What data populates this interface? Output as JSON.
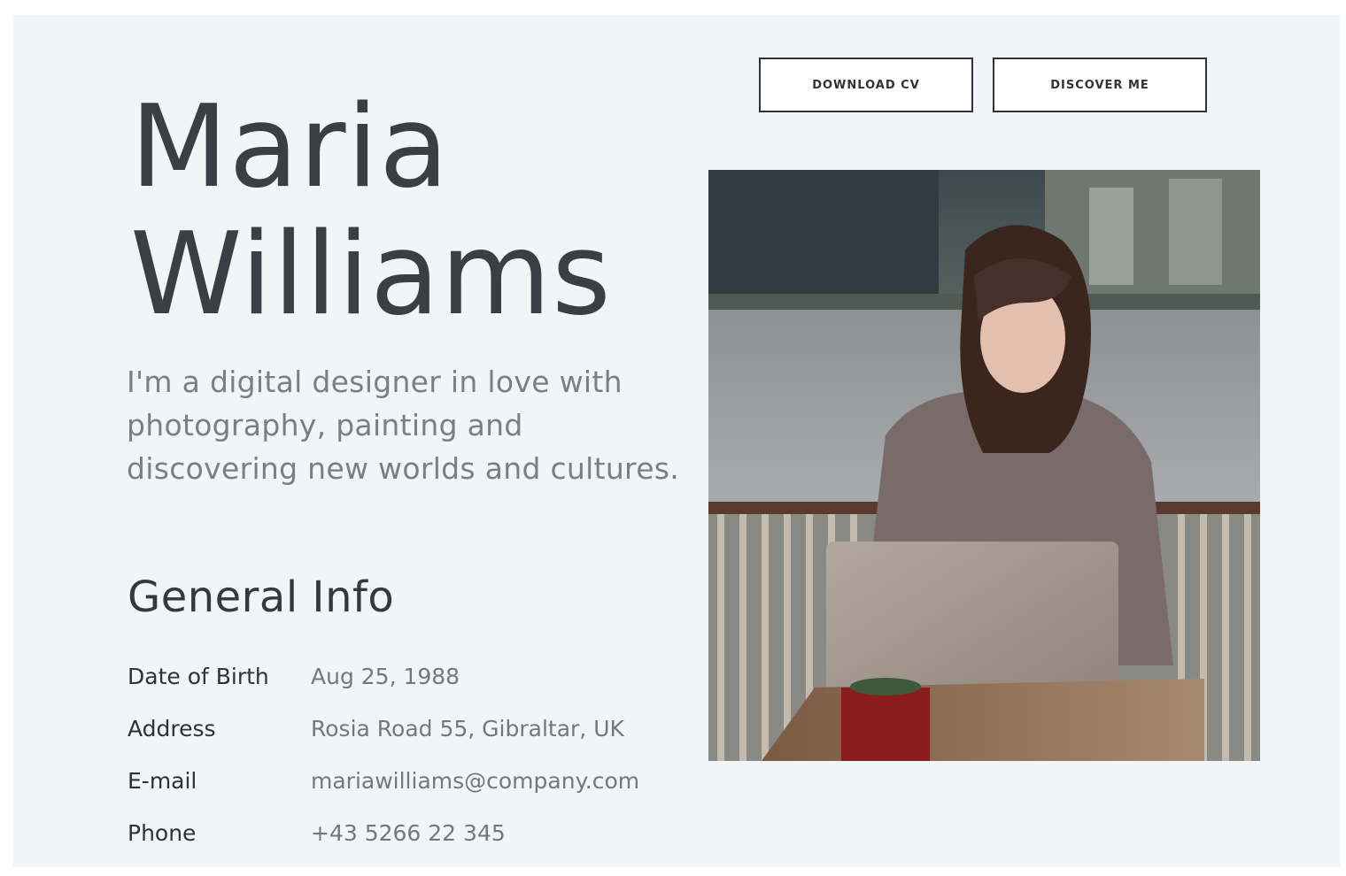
{
  "profile": {
    "first_name": "Maria",
    "last_name": "Williams",
    "intro": "I'm a digital designer in love with photography, painting and discovering new worlds and cultures."
  },
  "actions": {
    "download_cv": "DOWNLOAD CV",
    "discover_me": "DISCOVER ME"
  },
  "general_info": {
    "title": "General Info",
    "rows": [
      {
        "label": "Date of Birth",
        "value": "Aug 25, 1988"
      },
      {
        "label": "Address",
        "value": "Rosia Road 55, Gibraltar, UK"
      },
      {
        "label": "E-mail",
        "value": "mariawilliams@company.com"
      },
      {
        "label": "Phone",
        "value": "+43 5266 22 345"
      }
    ]
  },
  "colors": {
    "background": "#f1f5f8",
    "heading": "#3b3e44",
    "body_text": "#7c7e82"
  },
  "icons": {
    "laptop_logo": "apple-logo-icon"
  }
}
